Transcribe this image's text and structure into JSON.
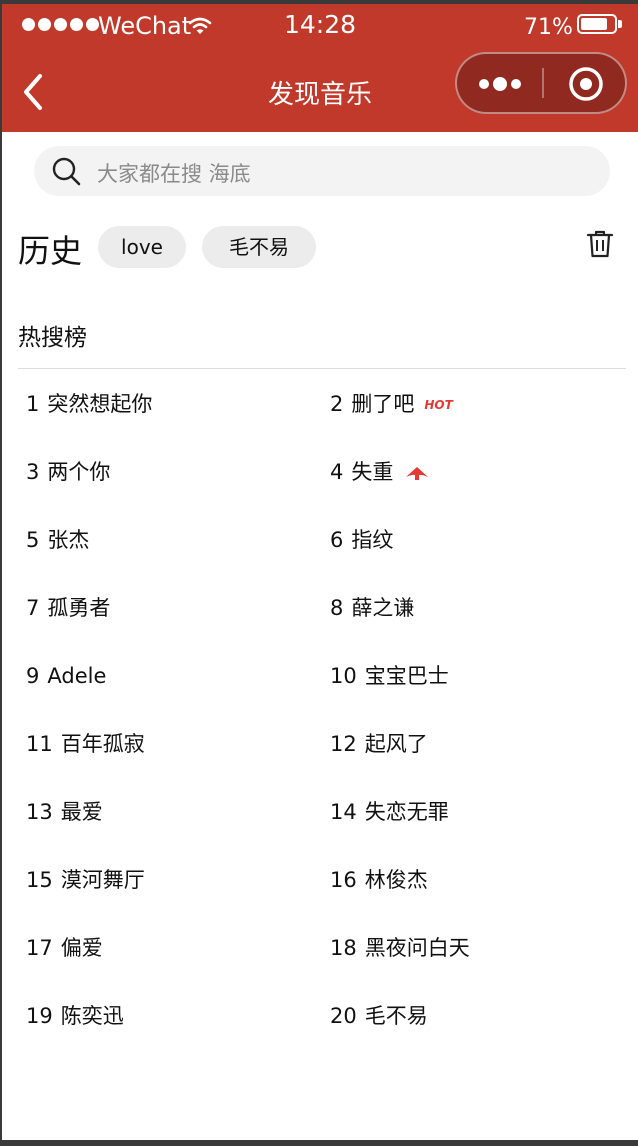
{
  "status_bar": {
    "carrier": "WeChat",
    "time": "14:28",
    "battery": "71%"
  },
  "nav": {
    "title": "发现音乐",
    "back_icon": "chevron-left-icon",
    "more_icon": "more-dots-icon",
    "close_icon": "target-circle-icon"
  },
  "search": {
    "placeholder": "大家都在搜 海底"
  },
  "history": {
    "title": "历史",
    "chips": [
      "love",
      "毛不易"
    ]
  },
  "hot": {
    "title": "热搜榜",
    "items": [
      {
        "rank": "1",
        "name": "突然想起你"
      },
      {
        "rank": "2",
        "name": "删了吧",
        "badge": "HOT"
      },
      {
        "rank": "3",
        "name": "两个你"
      },
      {
        "rank": "4",
        "name": "失重",
        "badge_icon": "trend-up-icon"
      },
      {
        "rank": "5",
        "name": "张杰"
      },
      {
        "rank": "6",
        "name": "指纹"
      },
      {
        "rank": "7",
        "name": "孤勇者"
      },
      {
        "rank": "8",
        "name": "薛之谦"
      },
      {
        "rank": "9",
        "name": "Adele"
      },
      {
        "rank": "10",
        "name": "宝宝巴士"
      },
      {
        "rank": "11",
        "name": "百年孤寂"
      },
      {
        "rank": "12",
        "name": "起风了"
      },
      {
        "rank": "13",
        "name": "最爱"
      },
      {
        "rank": "14",
        "name": "失恋无罪"
      },
      {
        "rank": "15",
        "name": "漠河舞厅"
      },
      {
        "rank": "16",
        "name": "林俊杰"
      },
      {
        "rank": "17",
        "name": "偏爱"
      },
      {
        "rank": "18",
        "name": "黑夜问白天"
      },
      {
        "rank": "19",
        "name": "陈奕迅"
      },
      {
        "rank": "20",
        "name": "毛不易"
      }
    ]
  },
  "colors": {
    "header": "#c0392b",
    "hot_badge": "#e53935"
  }
}
